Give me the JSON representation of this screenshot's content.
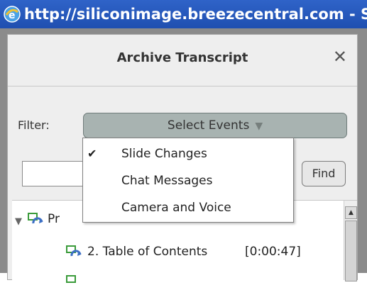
{
  "window": {
    "title": "http://siliconimage.breezecentral.com - S"
  },
  "dialog": {
    "title": "Archive Transcript",
    "close_symbol": "✕"
  },
  "filter": {
    "label": "Filter:",
    "select_label": "Select Events",
    "arrow": "▼"
  },
  "find": {
    "input_value": "",
    "button_label": "Find"
  },
  "dropdown": {
    "items": [
      {
        "label": "Slide Changes",
        "checked": true,
        "check_symbol": "✔"
      },
      {
        "label": "Chat Messages",
        "checked": false,
        "check_symbol": ""
      },
      {
        "label": "Camera and Voice",
        "checked": false,
        "check_symbol": ""
      }
    ]
  },
  "tree": {
    "root_label_partial": "Pr",
    "items": [
      {
        "label": "2. Table of Contents",
        "time": "[0:00:47]"
      }
    ]
  },
  "colors": {
    "titlebar": "#2f63c8",
    "select_button": "#a8b3b1",
    "icon_green": "#3a9b3a",
    "icon_blue": "#3c6fc4"
  }
}
